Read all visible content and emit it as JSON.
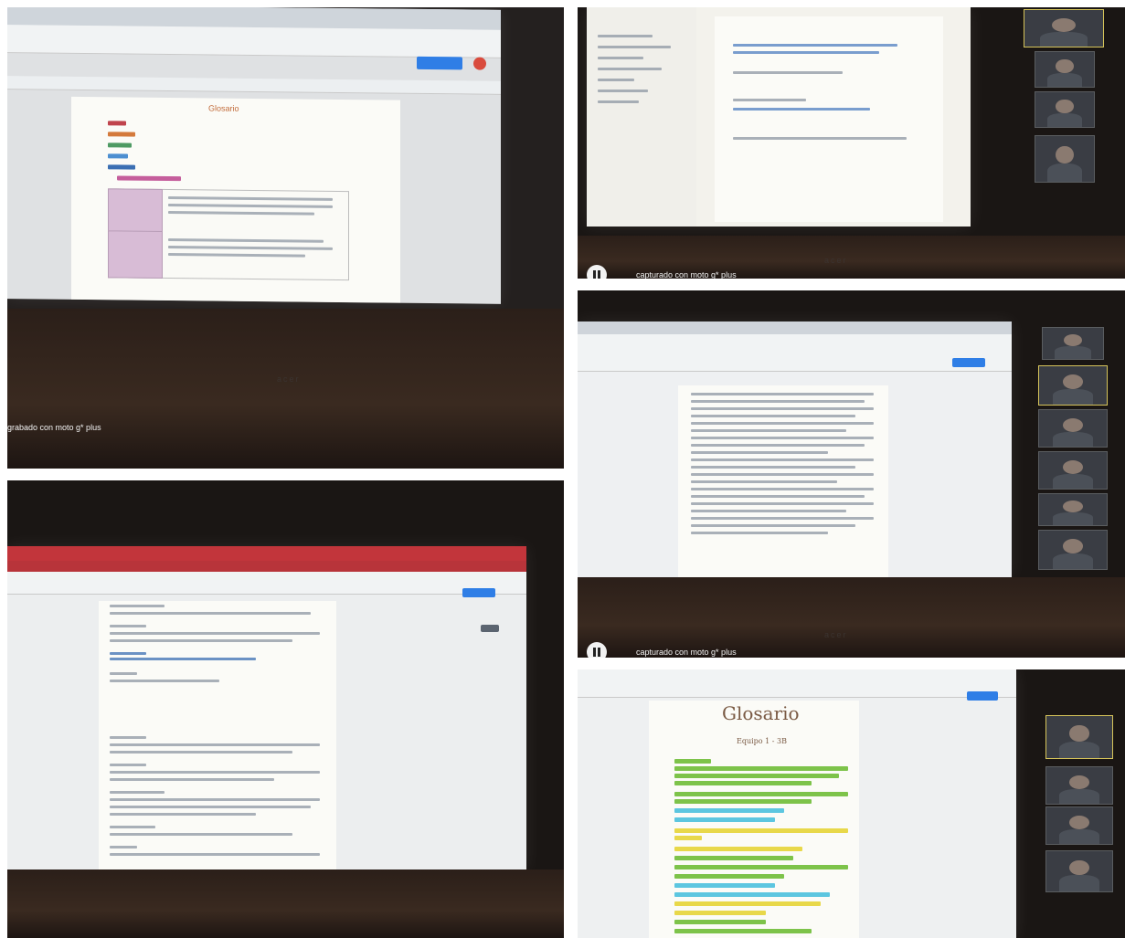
{
  "collage": {
    "panels": [
      {
        "id": "top-left",
        "caption": "grabado con moto g* plus",
        "logo": "acer"
      },
      {
        "id": "top-right",
        "caption": "capturado con moto g* plus",
        "logo": "acer"
      },
      {
        "id": "middle-right",
        "caption": "capturado con moto g* plus",
        "logo": "acer"
      },
      {
        "id": "bottom-left",
        "caption": "",
        "logo": ""
      },
      {
        "id": "bottom-right",
        "caption": "",
        "logo": ""
      }
    ]
  },
  "documents": {
    "top_left_heading": "Glosario",
    "bottom_right_heading": "Glosario",
    "bottom_right_subheading": "Equipo 1 - 3B"
  },
  "colors": {
    "highlight_green": "#7dc34a",
    "highlight_yellow": "#e8d84a",
    "highlight_cyan": "#5cc6e0",
    "table_purple": "#d8bcd6",
    "docs_blue_button": "#2f7ee6",
    "browser_red_tabbar": "#c2353b"
  }
}
